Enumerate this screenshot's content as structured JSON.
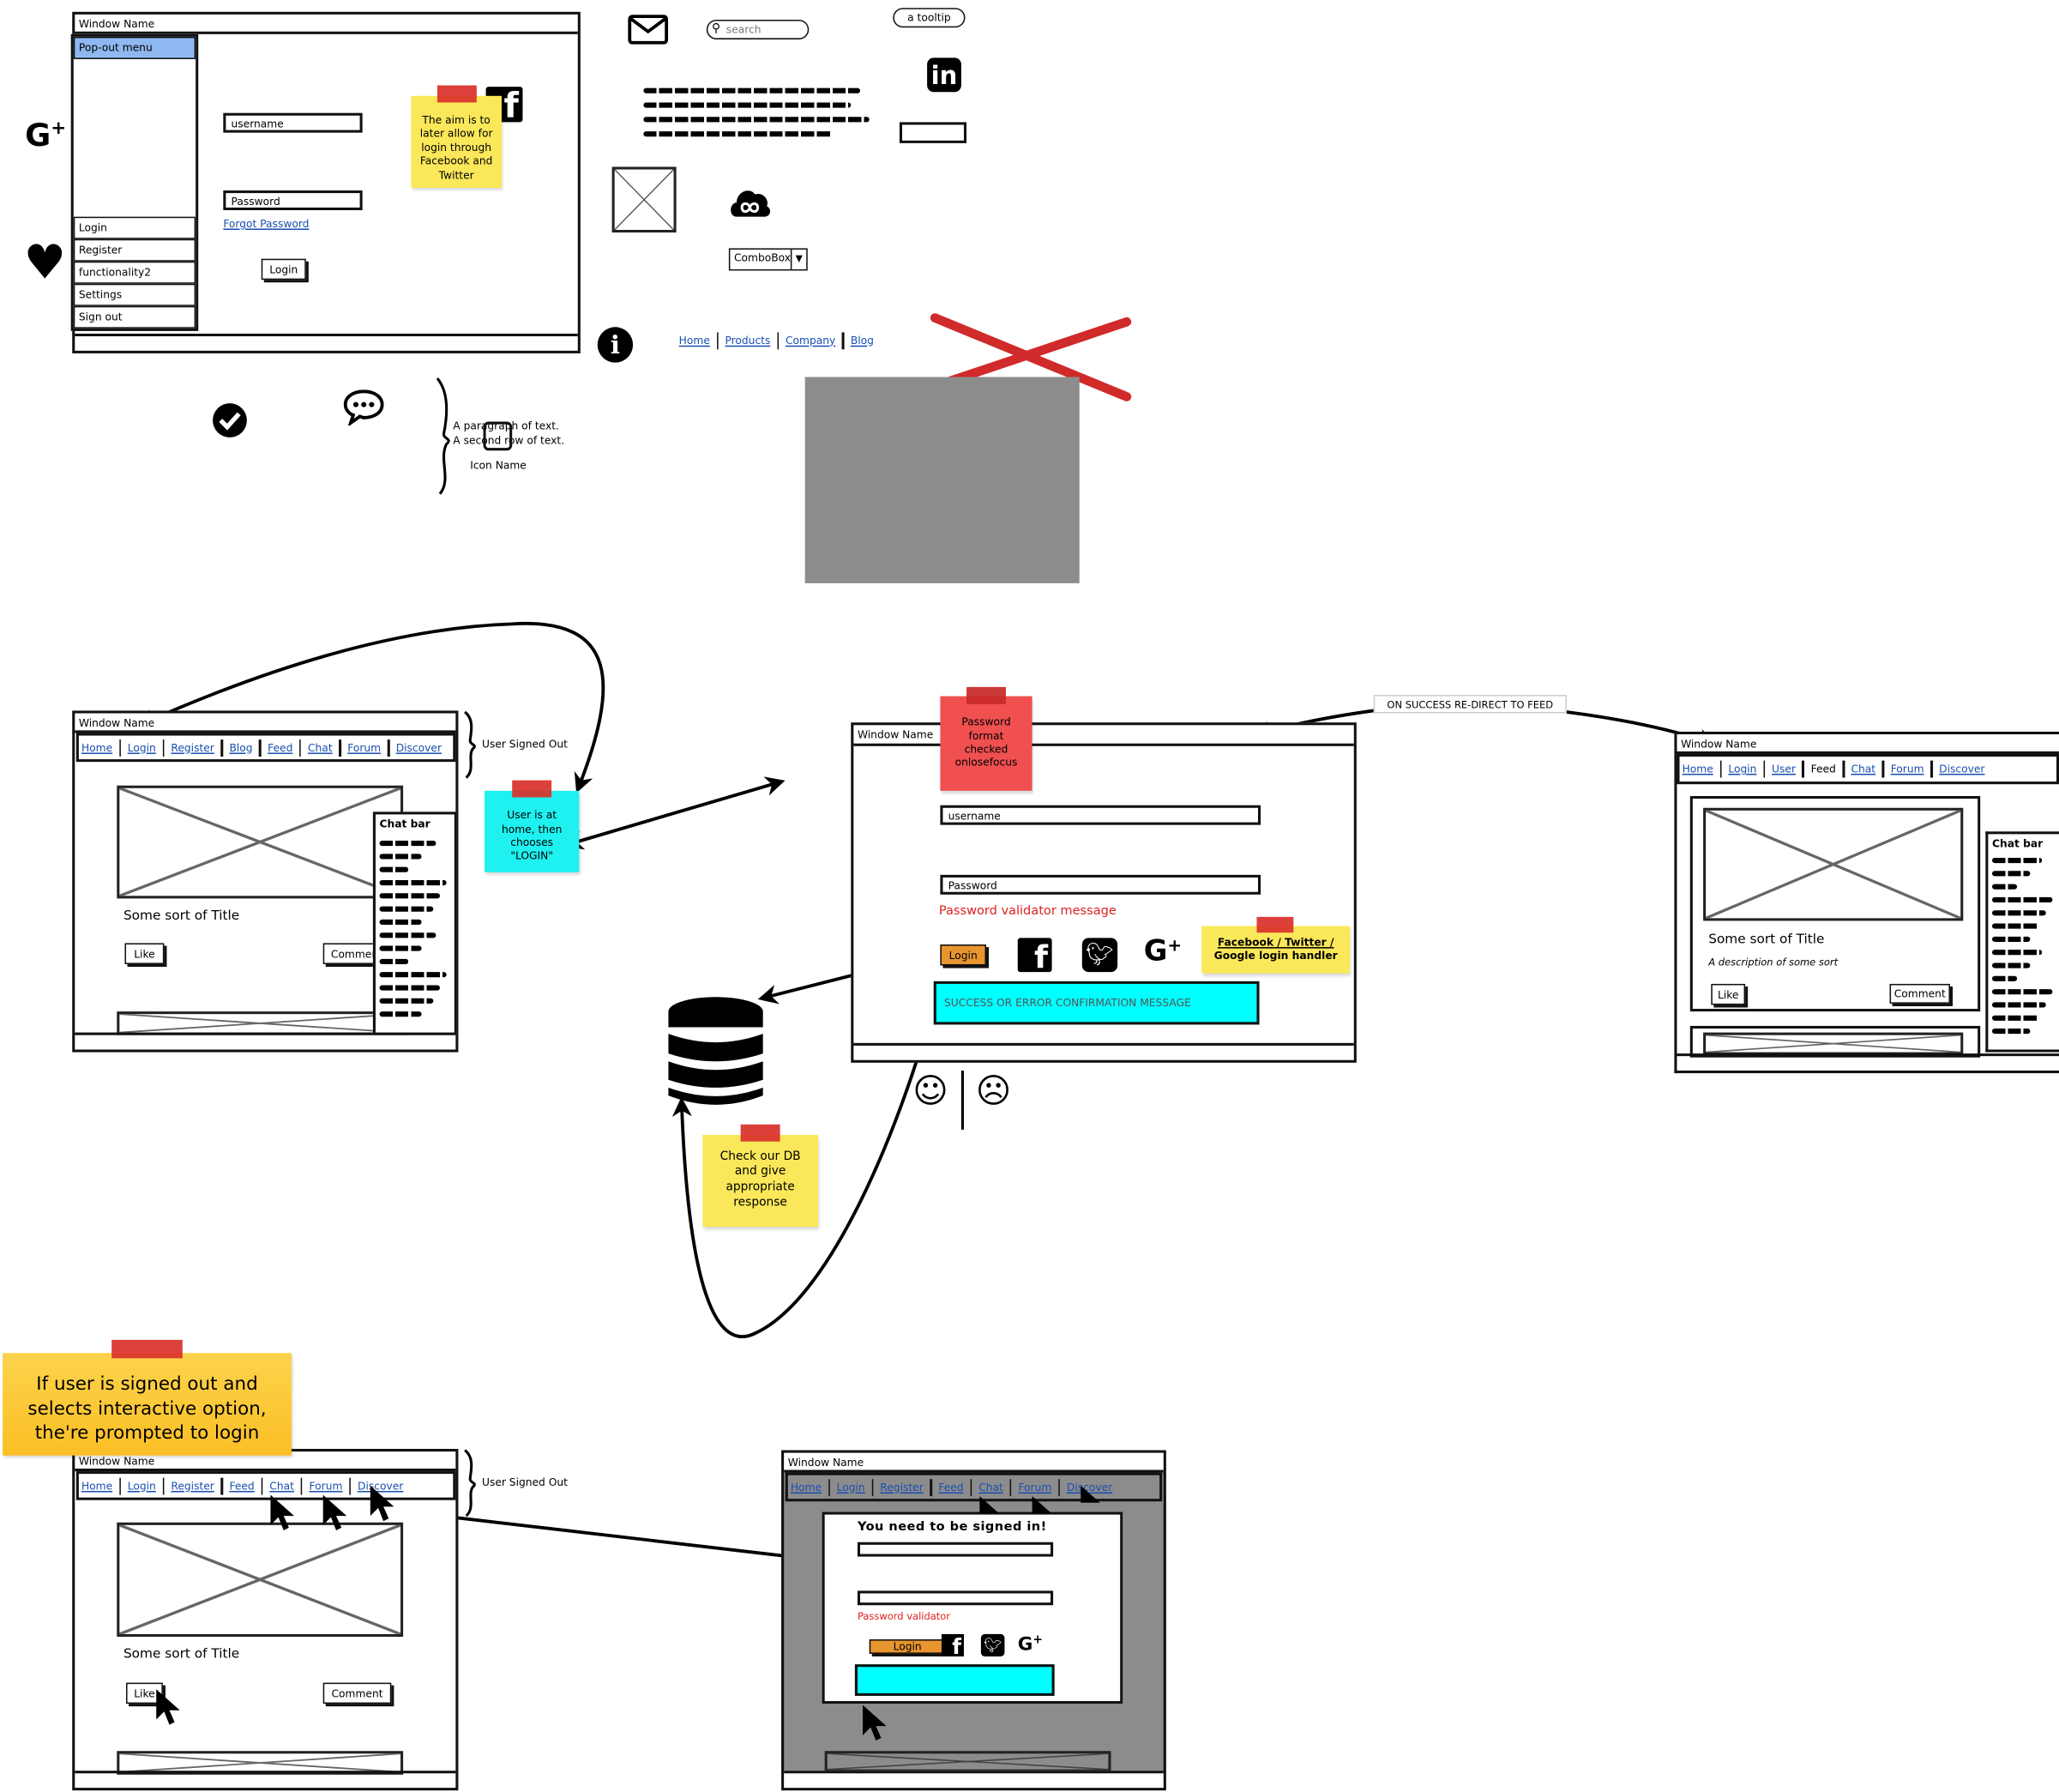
{
  "colors": {
    "accent_blue": "#8fb8f0",
    "sticky_yellow": "#fbe85a",
    "sticky_cyan": "#1ff0f0",
    "sticky_red": "#f05050",
    "sticky_orange": "#fbbf24",
    "login_orange": "#e8952f",
    "message_cyan": "#00ffff",
    "validator_red": "#e02020",
    "gray_overlay": "#8c8c8c",
    "cross_red": "#d02a2a"
  },
  "w1": {
    "title": "Window Name",
    "menu_header": "Pop-out menu",
    "menu": [
      "Login",
      "Register",
      "functionality2",
      "Settings",
      "Sign out"
    ],
    "username": "username",
    "password": "Password",
    "forgot": "Forgot Password",
    "login": "Login",
    "sticky": "The aim is to later allow for login through Facebook and Twitter"
  },
  "misc": {
    "search_placeholder": "search",
    "tooltip": "a tooltip",
    "combobox": "ComboBox",
    "nav": [
      "Home",
      "Products",
      "Company",
      "Blog"
    ],
    "para1": "A paragraph of text.",
    "para2": "A second row of text.",
    "icon_name": "Icon Name",
    "icons": [
      "google-plus-icon",
      "heart-icon",
      "envelope-icon",
      "linkedin-icon",
      "cloud-icon",
      "info-icon",
      "check-circle-icon",
      "chat-bubble-icon",
      "facebook-icon",
      "database-icon",
      "smiley-icon",
      "frown-icon",
      "cursor-icon",
      "twitter-icon"
    ]
  },
  "w2": {
    "title": "Window Name",
    "nav": [
      "Home",
      "Login",
      "Register",
      "Blog",
      "Feed",
      "Chat",
      "Forum",
      "Discover"
    ],
    "card_title": "Some sort of Title",
    "like": "Like",
    "comment": "Comment",
    "chat_bar": "Chat bar",
    "brace_label": "User Signed Out",
    "sticky": "User is at home, then chooses \"LOGIN\""
  },
  "w3": {
    "title": "Window Name",
    "sticky": "Password format checked onlosefocus",
    "username": "username",
    "password": "Password",
    "validator": "Password validator message",
    "login": "Login",
    "social_sticky_1": "Facebook / Twitter /",
    "social_sticky_2": "Google login handler",
    "message": "SUCCESS OR ERROR CONFIRMATION MESSAGE",
    "redirect_label": "ON SUCCESS RE-DIRECT TO FEED",
    "db_sticky": "Check our DB and give appropriate response"
  },
  "w4": {
    "title": "Window Name",
    "nav": [
      "Home",
      "Login",
      "User",
      "Feed",
      "Chat",
      "Forum",
      "Discover"
    ],
    "active_nav": "Feed",
    "card_title": "Some sort of Title",
    "description": "A description of some sort",
    "like": "Like",
    "comment": "Comment",
    "chat_bar": "Chat bar"
  },
  "w5": {
    "sticky": "If user is signed out and selects interactive option, the're prompted to login",
    "title": "Window Name",
    "nav": [
      "Home",
      "Login",
      "Register",
      "Feed",
      "Chat",
      "Forum",
      "Discover"
    ],
    "card_title": "Some sort of Title",
    "like": "Like",
    "comment": "Comment",
    "brace_label": "User Signed Out"
  },
  "w6": {
    "title": "Window Name",
    "nav": [
      "Home",
      "Login",
      "Register",
      "Feed",
      "Chat",
      "Forum",
      "Discover"
    ],
    "modal_title": "You need to be signed in!",
    "validator": "Password validator",
    "login": "Login"
  }
}
